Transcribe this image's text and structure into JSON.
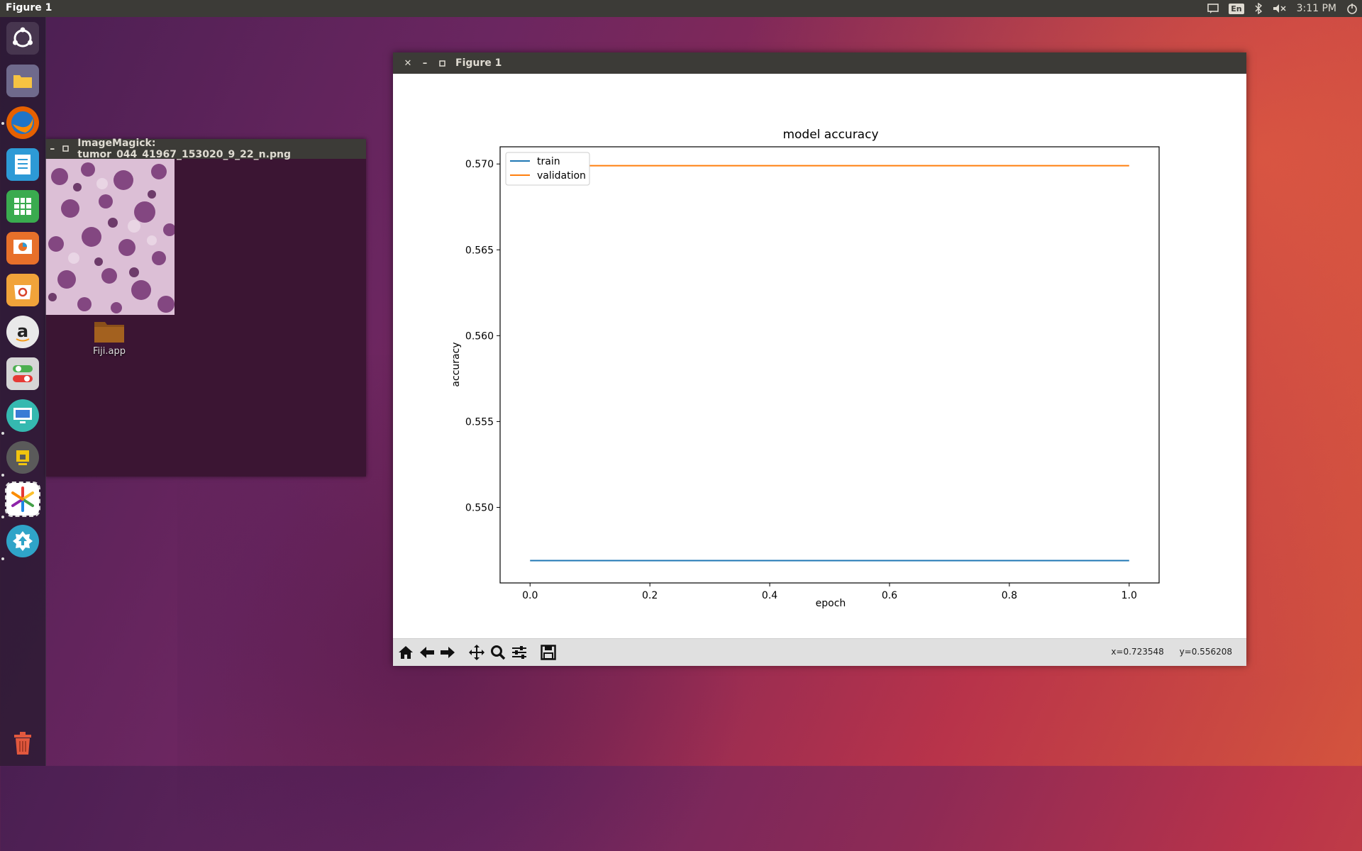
{
  "top_panel": {
    "title": "Figure 1",
    "keyboard_layout": "En",
    "clock": "3:11 PM"
  },
  "launcher": {
    "items": [
      {
        "name": "ubuntu-dash-icon"
      },
      {
        "name": "files-icon"
      },
      {
        "name": "firefox-icon"
      },
      {
        "name": "writer-icon"
      },
      {
        "name": "calc-icon"
      },
      {
        "name": "impress-icon"
      },
      {
        "name": "software-center-icon"
      },
      {
        "name": "amazon-icon"
      },
      {
        "name": "settings-icon"
      },
      {
        "name": "remote-desktop-icon"
      },
      {
        "name": "lock-screen-icon"
      },
      {
        "name": "fiji-icon"
      },
      {
        "name": "software-updater-icon"
      },
      {
        "name": "trash-icon"
      }
    ]
  },
  "imagemagick_window": {
    "title": "ImageMagick: tumor_044_41967_153020_9_22_n.png"
  },
  "desktop": {
    "icon_label": "Fiji.app"
  },
  "figure_window": {
    "title": "Figure 1",
    "coords": {
      "x": "x=0.723548",
      "y": "y=0.556208"
    }
  },
  "colors": {
    "train": "#1f77b4",
    "validation": "#ff7f0e",
    "titlebar": "#3c3b37"
  },
  "chart_data": {
    "type": "line",
    "title": "model accuracy",
    "xlabel": "epoch",
    "ylabel": "accuracy",
    "xlim": [
      -0.05,
      1.05
    ],
    "ylim": [
      0.5456,
      0.571
    ],
    "xticks": [
      "0.0",
      "0.2",
      "0.4",
      "0.6",
      "0.8",
      "1.0"
    ],
    "yticks": [
      "0.550",
      "0.555",
      "0.560",
      "0.565",
      "0.570"
    ],
    "legend_position": "top-left",
    "series": [
      {
        "name": "train",
        "x": [
          0.0,
          1.0
        ],
        "values": [
          0.5469,
          0.5469
        ]
      },
      {
        "name": "validation",
        "x": [
          0.0,
          1.0
        ],
        "values": [
          0.5699,
          0.5699
        ]
      }
    ]
  }
}
